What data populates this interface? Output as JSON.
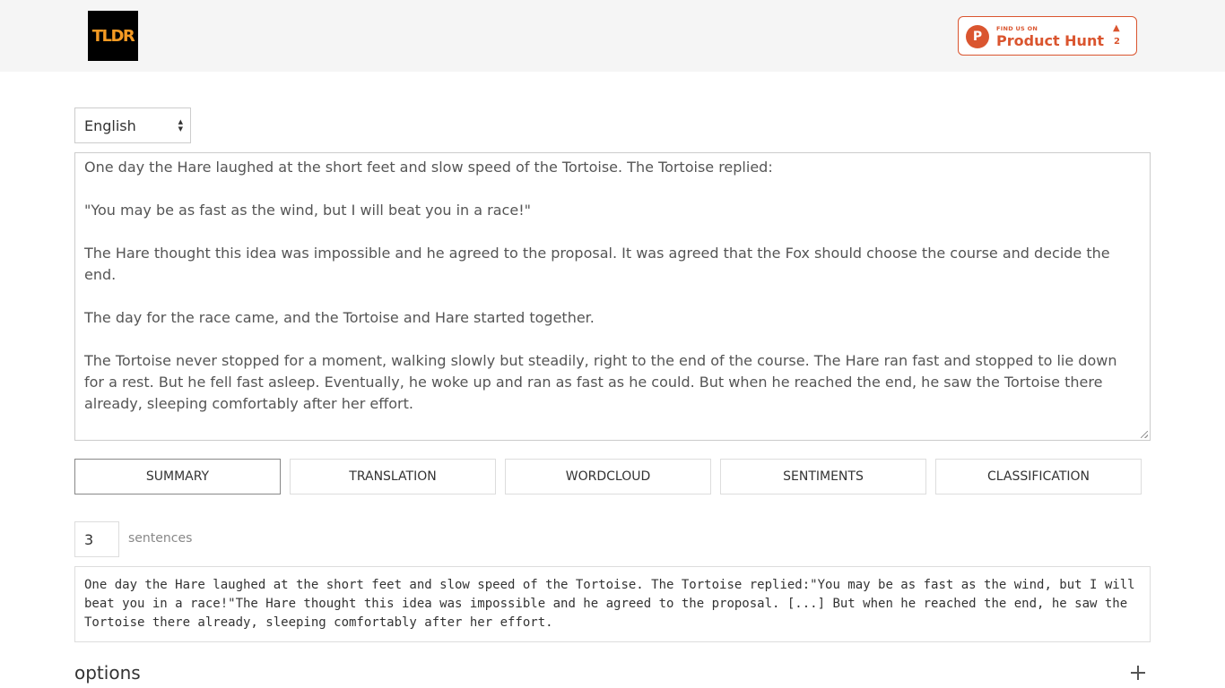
{
  "header": {
    "logo_text": "TLDR",
    "logo_color": "#f59a23",
    "product_hunt": {
      "icon_letter": "P",
      "small_text": "FIND US ON",
      "big_text": "Product Hunt",
      "arrow": "▲",
      "count": "2",
      "color": "#da552f"
    }
  },
  "language": {
    "selected": "English"
  },
  "input_text": {
    "paragraphs": [
      "One day the Hare laughed at the short feet and slow speed of the Tortoise. The Tortoise replied:",
      "\"You may be as fast as the wind, but I will beat you in a race!\"",
      "The Hare thought this idea was impossible and he agreed to the proposal. It was agreed that the Fox should choose the course and decide the end.",
      "The day for the race came, and the Tortoise and Hare started together.",
      "The Tortoise never stopped for a moment, walking slowly but steadily, right to the end of the course. The Hare ran fast and stopped to lie down for a rest. But he fell fast asleep. Eventually, he woke up and ran as fast as he could. But when he reached the end, he saw the Tortoise there already, sleeping comfortably after her effort."
    ]
  },
  "tabs": [
    {
      "label": "SUMMARY",
      "active": true
    },
    {
      "label": "TRANSLATION",
      "active": false
    },
    {
      "label": "WORDCLOUD",
      "active": false
    },
    {
      "label": "SENTIMENTS",
      "active": false
    },
    {
      "label": "CLASSIFICATION",
      "active": false
    }
  ],
  "summary": {
    "sentences_value": "3",
    "sentences_label": "sentences",
    "output": "One day the Hare laughed at the short feet and slow speed of the Tortoise. The Tortoise replied:\"You may be as fast as the wind, but I will beat you in a race!\"The Hare thought this idea was impossible and he agreed to the proposal. [...] But when he reached the end, he saw the Tortoise there already, sleeping comfortably after her effort."
  },
  "options": {
    "title": "options",
    "toggle_icon": "plus-icon"
  }
}
